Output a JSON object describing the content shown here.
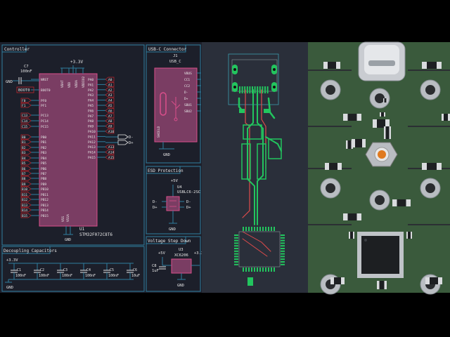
{
  "schematic": {
    "sections": {
      "controller": "Controller",
      "usbc": "USB-C Connector",
      "esd": "ESD Protection",
      "vreg": "Voltage Step Down",
      "decoupling": "Decoupling Capacitors"
    },
    "mcu": {
      "ref": "U1",
      "part": "STM32F072C8T6",
      "power_label": "+3.3V",
      "gnd_label": "GND",
      "left_pins": [
        "NRST",
        "BOOT0",
        "PF0",
        "PF1",
        "PC13",
        "PC14",
        "PC15",
        "PB0",
        "PB1",
        "PB2",
        "PB3",
        "PB4",
        "PB5",
        "PB6",
        "PB7",
        "PB8",
        "PB9",
        "PB10",
        "PB11",
        "PB12",
        "PB13",
        "PB14",
        "PB15"
      ],
      "left_nets": [
        "",
        "BOOT0",
        "F0",
        "F1",
        "C13",
        "C14",
        "C15",
        "B0",
        "B1",
        "B2",
        "B3",
        "B4",
        "B5",
        "B6",
        "B7",
        "B8",
        "B9",
        "B10",
        "B11",
        "B12",
        "B13",
        "B14",
        "B15"
      ],
      "right_pins": [
        "PA0",
        "PA1",
        "PA2",
        "PA3",
        "PA4",
        "PA5",
        "PA6",
        "PA7",
        "PA8",
        "PA9",
        "PA10",
        "PA11",
        "PA12",
        "PA13",
        "PA14",
        "PA15"
      ],
      "right_nets": [
        "A0",
        "A1",
        "A2",
        "A3",
        "A4",
        "A5",
        "A6",
        "A7",
        "A8",
        "A9",
        "A10",
        "",
        "",
        "A13",
        "A14",
        "A15"
      ],
      "top_pins": [
        "VBAT",
        "VDD",
        "VDDA",
        "VDDIO2"
      ],
      "bottom_pins": [
        "VSS",
        "VSSA"
      ],
      "dm_label": "D-",
      "dp_label": "D+"
    },
    "c7": {
      "ref": "C7",
      "value": "100nF",
      "gnd": "GND"
    },
    "usb": {
      "ref": "J1",
      "part": "USB_C",
      "pins": [
        "VBUS",
        "CC1",
        "CC2",
        "D-",
        "D+",
        "SBU1",
        "SBU2"
      ],
      "shield": "SHIELD",
      "gnd": "GND",
      "vbus_net": "+5V"
    },
    "esd": {
      "ref": "U4",
      "part": "USBLC6-2SC",
      "power": "+5V",
      "gnd": "GND",
      "left_nets": [
        "D-",
        "D+"
      ],
      "right_nets": [
        "D-",
        "D+"
      ]
    },
    "vreg": {
      "ref": "U3",
      "part": "XC6206",
      "in_net": "+5V",
      "out_net": "+3.3V",
      "cap_ref": "C8",
      "cap_val": "1uF",
      "gnd": "GND"
    },
    "decoupling": {
      "power": "+3.3V",
      "gnd": "GND",
      "caps": [
        {
          "ref": "C1",
          "value": "100nF"
        },
        {
          "ref": "C2",
          "value": "100nF"
        },
        {
          "ref": "C3",
          "value": "100nF"
        },
        {
          "ref": "C4",
          "value": "100nF"
        },
        {
          "ref": "C5",
          "value": "100nF"
        },
        {
          "ref": "C6",
          "value": "10uF"
        }
      ]
    }
  },
  "colors": {
    "bg": "#000000",
    "sch_bg": "#1c1f2a",
    "sch_line": "#2f7fa0",
    "sch_text": "#e6e6e6",
    "sch_part": "#c0262d",
    "sch_body": "#7a3d63",
    "sch_pin": "#d94f8b",
    "pcb_bg": "#2a2f3a",
    "pcb_copper_front": "#22c55e",
    "pcb_copper_back": "#e04b4b",
    "pcb_edge": "#3c9dad",
    "board_green": "#3a5a3c",
    "board_pad": "#c9c9c9"
  }
}
